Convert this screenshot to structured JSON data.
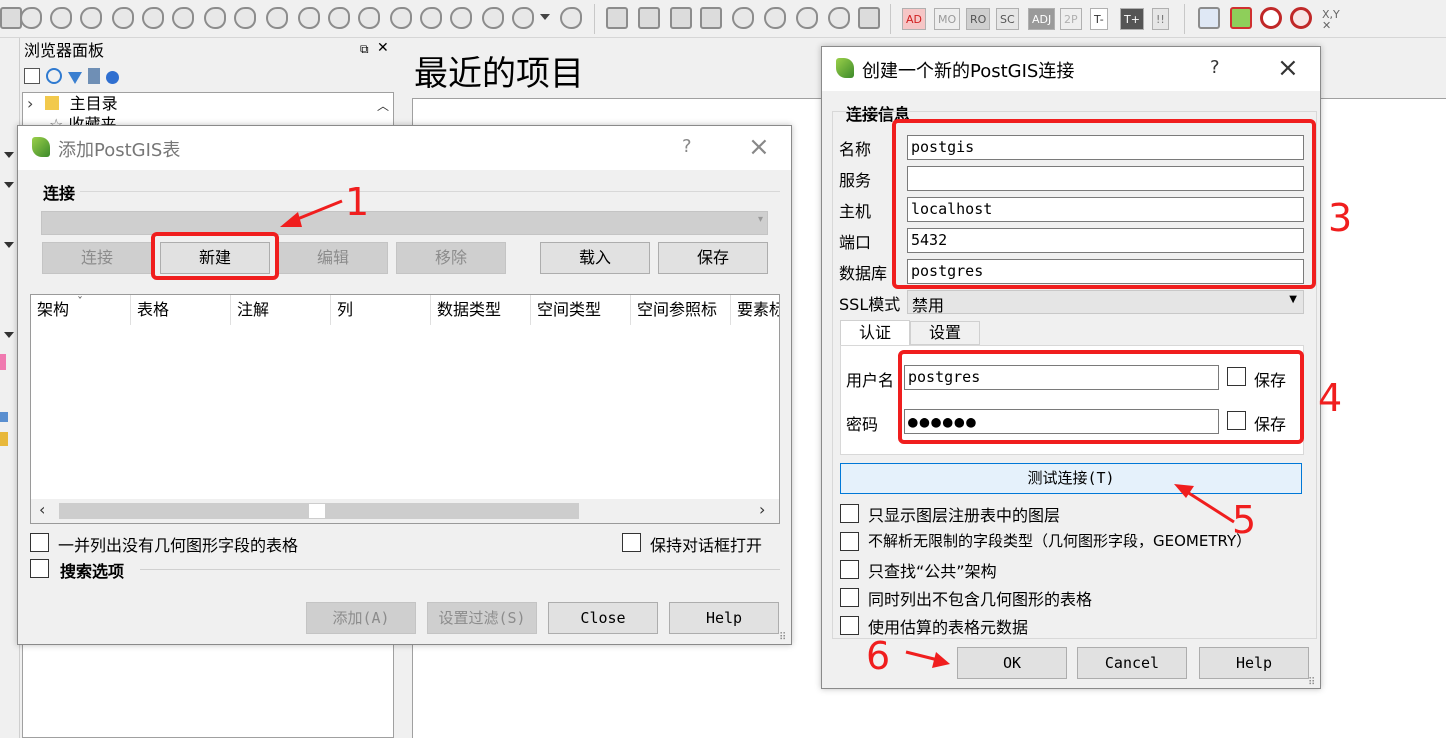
{
  "browser_panel": {
    "title": "浏览器面板",
    "tree": [
      "主目录",
      "收藏夹"
    ]
  },
  "recent": {
    "title": "最近的项目"
  },
  "add_dialog": {
    "title": "添加PostGIS表",
    "help": "?",
    "close": "×",
    "group_label": "连接",
    "buttons": {
      "connect": "连接",
      "new": "新建",
      "edit": "编辑",
      "remove": "移除",
      "load": "载入",
      "save": "保存"
    },
    "columns": [
      "架构",
      "表格",
      "注解",
      "列",
      "数据类型",
      "空间类型",
      "空间参照标",
      "要素标"
    ],
    "list_no_geom": "一并列出没有几何图形字段的表格",
    "keep_open": "保持对话框打开",
    "search_options": "搜索选项",
    "footer": {
      "add": "添加(A)",
      "set_filter": "设置过滤(S)",
      "close": "Close",
      "help": "Help"
    }
  },
  "new_dialog": {
    "title": "创建一个新的PostGIS连接",
    "help": "?",
    "close": "×",
    "section": "连接信息",
    "fields": [
      {
        "label": "名称",
        "value": "postgis"
      },
      {
        "label": "服务",
        "value": ""
      },
      {
        "label": "主机",
        "value": "localhost"
      },
      {
        "label": "端口",
        "value": "5432"
      },
      {
        "label": "数据库",
        "value": "postgres"
      }
    ],
    "ssl_label": "SSL模式",
    "ssl_value": "禁用",
    "tabs": [
      "认证",
      "设置"
    ],
    "username_label": "用户名",
    "username_value": "postgres",
    "password_label": "密码",
    "password_value": "●●●●●●",
    "save_label": "保存",
    "test_button": "测试连接(T)",
    "options": [
      "只显示图层注册表中的图层",
      "不解析无限制的字段类型（几何图形字段，GEOMETRY）",
      "只查找“公共”架构",
      "同时列出不包含几何图形的表格",
      "使用估算的表格元数据"
    ],
    "footer": {
      "ok": "OK",
      "cancel": "Cancel",
      "help": "Help"
    }
  },
  "annotations": [
    "1",
    "3",
    "4",
    "5",
    "6"
  ],
  "colors": {
    "annotation_red": "#f01e1e",
    "accent_blue": "#0078d7"
  }
}
